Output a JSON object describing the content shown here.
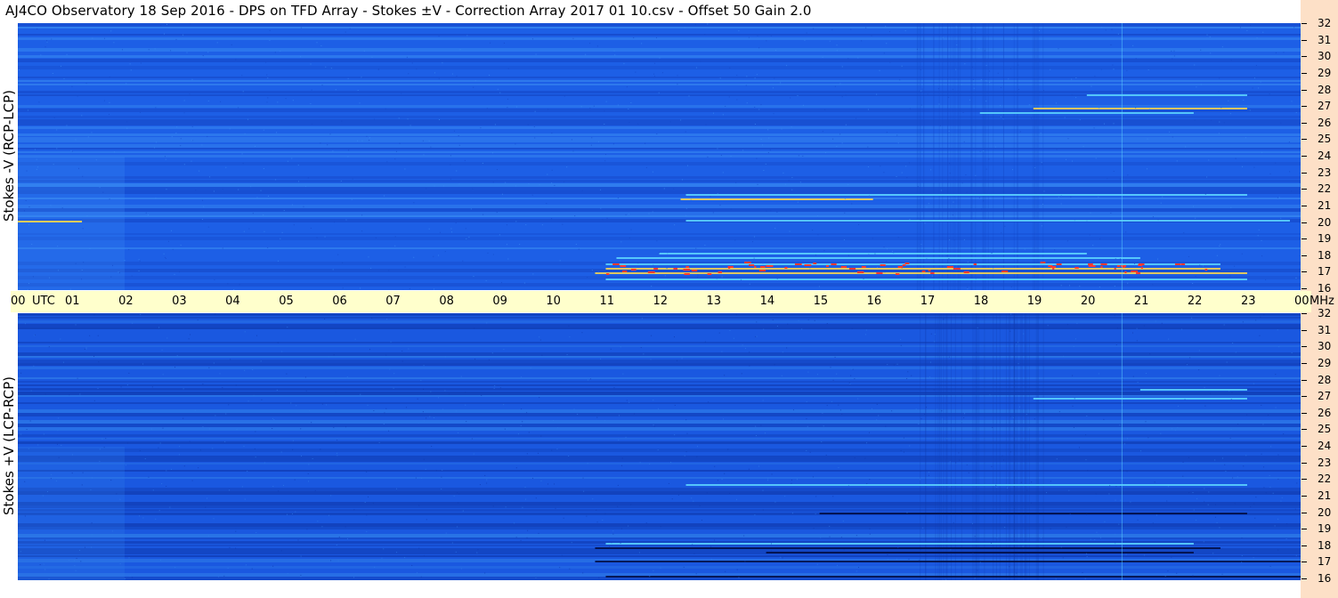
{
  "title": "AJ4CO Observatory  18 Sep 2016  -  DPS on TFD Array  -  Stokes ±V  -  Correction Array 2017 01 10.csv  -  Offset 50  Gain 2.0",
  "chart_data": [
    {
      "type": "heatmap",
      "name": "top",
      "ylabel": "Stokes -V (RCP-LCP)",
      "ylim_mhz": [
        16,
        32
      ],
      "colors": {
        "background": "#1d5fe6",
        "band_dark": "#1548c8",
        "band_light": "#3a8cf2",
        "emission": "#5fd8ff",
        "hot": "#ffd84a",
        "peak": "#ff3b2f"
      }
    },
    {
      "type": "heatmap",
      "name": "bottom",
      "ylabel": "Stokes +V (LCP-RCP)",
      "ylim_mhz": [
        16,
        32
      ],
      "colors": {
        "background": "#1a58e0",
        "band_dark": "#0f3ab0",
        "band_light": "#2f7ce8",
        "emission": "#5fd8ff",
        "dark_emission": "#020c40"
      }
    }
  ],
  "x_axis": {
    "labels": [
      "00",
      "UTC",
      "01",
      "02",
      "03",
      "04",
      "05",
      "06",
      "07",
      "08",
      "09",
      "10",
      "11",
      "12",
      "13",
      "14",
      "15",
      "16",
      "17",
      "18",
      "19",
      "20",
      "21",
      "22",
      "23",
      "00"
    ],
    "unit": "MHz",
    "hours": [
      0,
      1,
      2,
      3,
      4,
      5,
      6,
      7,
      8,
      9,
      10,
      11,
      12,
      13,
      14,
      15,
      16,
      17,
      18,
      19,
      20,
      21,
      22,
      23,
      24
    ]
  },
  "y_axis": {
    "ticks": [
      "32",
      "31",
      "30",
      "29",
      "28",
      "27",
      "26",
      "25",
      "24",
      "23",
      "22",
      "21",
      "20",
      "19",
      "18",
      "17",
      "16"
    ]
  }
}
